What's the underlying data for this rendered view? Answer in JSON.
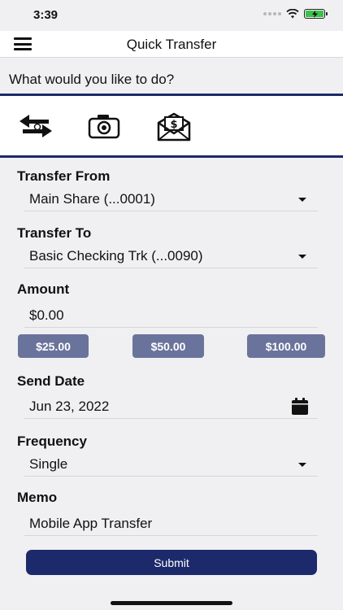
{
  "status_bar": {
    "time": "3:39",
    "icons": [
      "signal-dots-icon",
      "wifi-icon",
      "battery-charging-icon"
    ],
    "battery_color": "#3ac24a"
  },
  "nav": {
    "title": "Quick Transfer",
    "menu_icon": "hamburger-menu-icon"
  },
  "prompt": "What would you like to do?",
  "actions": [
    {
      "icon": "transfer-arrows-icon"
    },
    {
      "icon": "camera-icon"
    },
    {
      "icon": "envelope-dollar-icon"
    }
  ],
  "form": {
    "transfer_from": {
      "label": "Transfer From",
      "value": "Main Share (...0001)"
    },
    "transfer_to": {
      "label": "Transfer To",
      "value": "Basic Checking Trk (...0090)"
    },
    "amount": {
      "label": "Amount",
      "value": "$0.00",
      "quick_amounts": [
        "$25.00",
        "$50.00",
        "$100.00"
      ]
    },
    "send_date": {
      "label": "Send Date",
      "value": "Jun 23, 2022"
    },
    "frequency": {
      "label": "Frequency",
      "value": "Single"
    },
    "memo": {
      "label": "Memo",
      "value": "Mobile App Transfer"
    },
    "submit_label": "Submit"
  },
  "colors": {
    "primary": "#1c2a6b",
    "quick_button": "#6a739b",
    "background": "#f0f0f2"
  }
}
